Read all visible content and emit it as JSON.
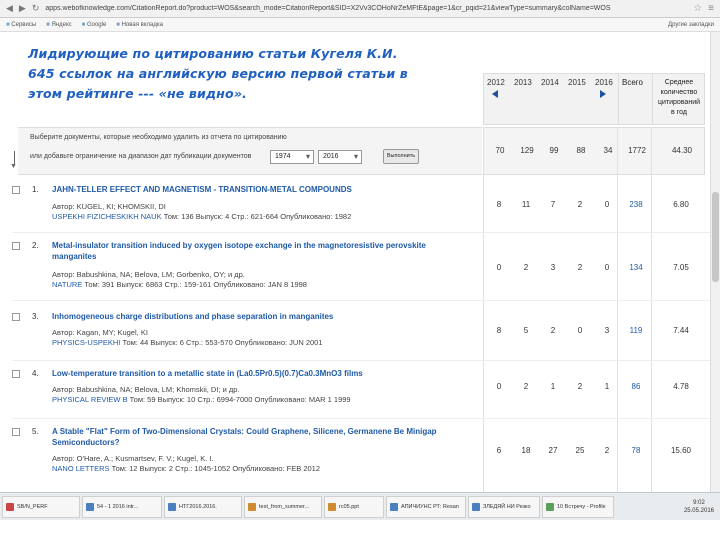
{
  "browser": {
    "url": "apps.webofknowledge.com/CitationReport.do?product=WOS&search_mode=CitationReport&SID=X2Vv3COHoNrZeMFtE&page=1&cr_pqid=21&viewType=summary&colName=WOS",
    "bookmarks": [
      "Сервисы",
      "Яндекс",
      "Google",
      "Новая вкладка"
    ],
    "bookmarks_right": "Другие закладки"
  },
  "overlay_text": [
    "Лидирующие по цитированию статьи Кугеля К.И.",
    "645 ссылок на английскую версию первой статьи в",
    "этом рейтинге --- «не видно»."
  ],
  "header": {
    "years": [
      "2012",
      "2013",
      "2014",
      "2015",
      "2016"
    ],
    "total_label": "Всего",
    "avg_label": "Среднее количество цитирований в год"
  },
  "filter": {
    "line1": "Выберите документы, которые необходимо удалить из отчета по цитированию",
    "line2": "или добавьте ограничение на диапазон дат публикации документов",
    "from_year": "1974",
    "dash": "и",
    "to_year": "2016",
    "go_label": "Выполнить"
  },
  "totals": [
    "70",
    "129",
    "99",
    "88",
    "34",
    "1772",
    "44.30"
  ],
  "records": [
    {
      "n": "1.",
      "title": "JAHN-TELLER EFFECT AND MAGNETISM - TRANSITION-METAL COMPOUNDS",
      "authors": "Автор: KUGEL, KI; KHOMSKII, DI",
      "source_journal": "USPEKHI FIZICHESKIKH NAUK",
      "source_rest": "Том: 136 Выпуск: 4 Стр.: 621-664 Опубликовано: 1982",
      "values": [
        "8",
        "11",
        "7",
        "2",
        "0",
        "238",
        "6.80"
      ]
    },
    {
      "n": "2.",
      "title": "Metal-insulator transition induced by oxygen isotope exchange in the magnetoresistive perovskite manganites",
      "authors": "Автор: Babushkina, NA; Belova, LM; Gorbenko, OY; и др.",
      "source_journal": "NATURE",
      "source_rest": "Том: 391 Выпуск: 6863 Стр.: 159-161 Опубликовано: JAN 8 1998",
      "values": [
        "0",
        "2",
        "3",
        "2",
        "0",
        "134",
        "7.05"
      ]
    },
    {
      "n": "3.",
      "title": "Inhomogeneous charge distributions and phase separation in manganites",
      "authors": "Автор: Kagan, MY; Kugel, KI",
      "source_journal": "PHYSICS-USPEKHI",
      "source_rest": "Том: 44 Выпуск: 6 Стр.: 553-570 Опубликовано: JUN 2001",
      "values": [
        "8",
        "5",
        "2",
        "0",
        "3",
        "119",
        "7.44"
      ]
    },
    {
      "n": "4.",
      "title": "Low-temperature transition to a metallic state in (La0.5Pr0.5)(0.7)Ca0.3MnO3 films",
      "authors": "Автор: Babushkina, NA; Belova, LM; Khomskii, DI; и др.",
      "source_journal": "PHYSICAL REVIEW B",
      "source_rest": "Том: 59 Выпуск: 10 Стр.: 6994-7000 Опубликовано: MAR 1 1999",
      "values": [
        "0",
        "2",
        "1",
        "2",
        "1",
        "86",
        "4.78"
      ]
    },
    {
      "n": "5.",
      "title": "A Stable \"Flat\" Form of Two-Dimensional Crystals: Could Graphene, Silicene, Germanene Be Minigap Semiconductors?",
      "authors": "Автор: O'Hare, A.; Kusmartsev, F. V.; Kugel, K. I.",
      "source_journal": "NANO LETTERS",
      "source_rest": "Том: 12 Выпуск: 2 Стр.: 1045-1052 Опубликовано: FEB 2012",
      "values": [
        "6",
        "18",
        "27",
        "25",
        "2",
        "78",
        "15.60"
      ]
    }
  ],
  "taskbar": {
    "tasks": [
      "SB/N_PERF",
      "54 - 1 2016 intr...",
      "НТГ2016.2016.",
      "test_from_summer...",
      "rc05.ppt",
      "АПИЧИУНС РТ: Resan",
      "ЗЛЕДЯЙ НИ Резко",
      "10 Встречу - Profile"
    ],
    "time": "9:02",
    "date": "25.05.2016"
  },
  "colors": {
    "link": "#1f5aa8",
    "overlay": "#2060c0"
  }
}
